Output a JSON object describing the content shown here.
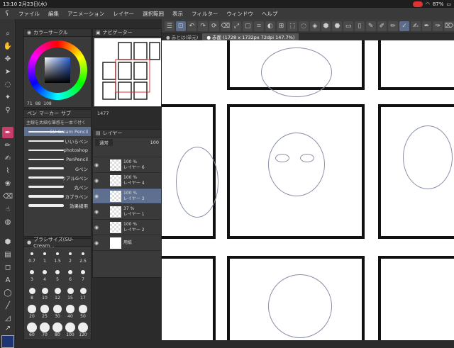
{
  "status": {
    "time": "13:10",
    "date": "2月23日(水)",
    "battery": "87%"
  },
  "menu": [
    "ファイル",
    "編集",
    "アニメーション",
    "レイヤー",
    "選択範囲",
    "表示",
    "フィルター",
    "ウィンドウ",
    "ヘルプ"
  ],
  "tabs": [
    {
      "label": "● 赤とは(単元)"
    },
    {
      "label": "● 赤面 (1728 x 1732px 72dpi 147.7%)"
    }
  ],
  "color_panel": {
    "title": "カラーサークル",
    "r": "71",
    "g": "88",
    "b": "108"
  },
  "nav_panel": {
    "title": "ナビゲーター",
    "zoom": "1477"
  },
  "subtool": {
    "tabs": [
      "ペン",
      "マーカー",
      "サブ"
    ],
    "header": "主線を太細な筆感を一本で付く",
    "brushes": [
      {
        "name": "SU-Cream Pencil"
      },
      {
        "name": "いいらペン"
      },
      {
        "name": "photoshop"
      },
      {
        "name": "PenPencil"
      },
      {
        "name": "Gペン"
      },
      {
        "name": "リアルGペン"
      },
      {
        "name": "丸ペン"
      },
      {
        "name": "カブラペン"
      },
      {
        "name": "効果線用"
      }
    ]
  },
  "layer_panel": {
    "title": "レイヤー",
    "blend": "通常",
    "opacity": "100",
    "layers": [
      {
        "pct": "100 %",
        "name": "レイヤー 6"
      },
      {
        "pct": "100 %",
        "name": "レイヤー 4"
      },
      {
        "pct": "100 %",
        "name": "レイヤー 3"
      },
      {
        "pct": "37 %",
        "name": "レイヤー 1"
      },
      {
        "pct": "100 %",
        "name": "レイヤー 2"
      },
      {
        "pct": "",
        "name": "用紙"
      }
    ]
  },
  "size_panel": {
    "title": "ブラシサイズ(SU-Cream...",
    "sizes": [
      "0.7",
      "1",
      "1.5",
      "2",
      "2.5",
      "3",
      "4",
      "5",
      "6",
      "7",
      "8",
      "10",
      "12",
      "15",
      "17",
      "20",
      "25",
      "30",
      "40",
      "50",
      "60",
      "70",
      "80",
      "100",
      "120"
    ]
  }
}
